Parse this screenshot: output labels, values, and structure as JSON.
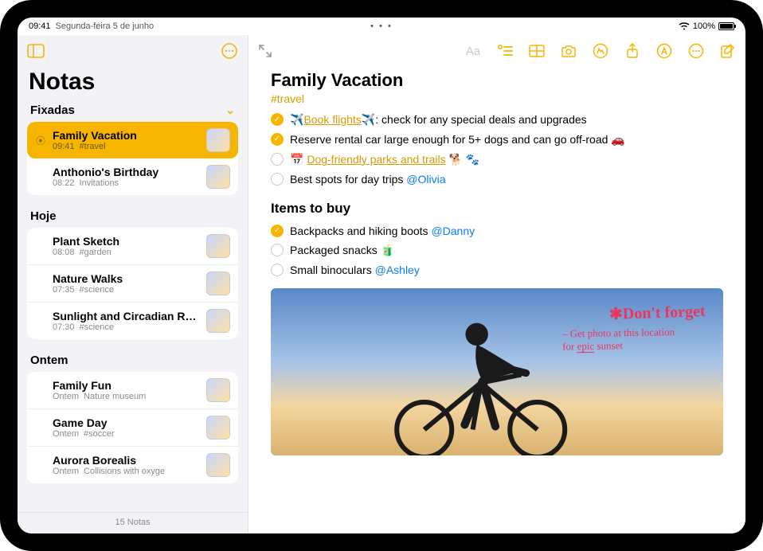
{
  "status": {
    "time": "09:41",
    "date": "Segunda-feira 5 de junho",
    "battery_pct": "100%",
    "dots": "• • •"
  },
  "sidebar": {
    "title": "Notas",
    "footer": "15 Notas",
    "sections": [
      {
        "label": "Fixadas",
        "collapsible": true,
        "notes": [
          {
            "title": "Family Vacation",
            "time": "09:41",
            "tag": "#travel",
            "selected": true,
            "pinned": true
          },
          {
            "title": "Anthonio's Birthday",
            "time": "08:22",
            "tag": "Invitations",
            "selected": false,
            "pinned": false
          }
        ]
      },
      {
        "label": "Hoje",
        "collapsible": false,
        "notes": [
          {
            "title": "Plant Sketch",
            "time": "08:08",
            "tag": "#garden"
          },
          {
            "title": "Nature Walks",
            "time": "07:35",
            "tag": "#science"
          },
          {
            "title": "Sunlight and Circadian Rhy...",
            "time": "07:30",
            "tag": "#science"
          }
        ]
      },
      {
        "label": "Ontem",
        "collapsible": false,
        "notes": [
          {
            "title": "Family Fun",
            "time": "Ontem",
            "tag": "Nature museum"
          },
          {
            "title": "Game Day",
            "time": "Ontem",
            "tag": "#soccer"
          },
          {
            "title": "Aurora Borealis",
            "time": "Ontem",
            "tag": "Collisions with oxyge"
          }
        ]
      }
    ]
  },
  "note": {
    "title": "Family Vacation",
    "tag": "#travel",
    "todos1": [
      {
        "done": true,
        "pre": "✈️",
        "link": "Book flights",
        "post": "✈️",
        "rest": ": check for any special deals and upgrades"
      },
      {
        "done": true,
        "rest": "Reserve rental car large enough for 5+ dogs and can go off-road 🚗"
      },
      {
        "done": false,
        "cal": "📅",
        "link": "Dog-friendly parks and trails",
        "post": " 🐕 🐾"
      },
      {
        "done": false,
        "rest": "Best spots for day trips ",
        "mention": "@Olivia"
      }
    ],
    "subhead": "Items to buy",
    "todos2": [
      {
        "done": true,
        "rest": "Backpacks and hiking boots ",
        "mention": "@Danny"
      },
      {
        "done": false,
        "rest": "Packaged snacks 🧃"
      },
      {
        "done": false,
        "rest": "Small binoculars ",
        "mention": "@Ashley"
      }
    ],
    "handwriting": {
      "line1": "✱Don't forget",
      "line2a": "– Get photo at this location",
      "line2b": "for ",
      "line2c": "epic",
      "line2d": " sunset"
    }
  },
  "icons": {
    "sidebar_toggle": "sidebar",
    "more": "ellipsis-circle",
    "expand": "expand",
    "format_text": "Aa",
    "checklist": "checklist",
    "table": "table",
    "camera": "camera",
    "markup": "markup",
    "share": "share",
    "lock_a": "a-circle",
    "compose": "compose"
  }
}
